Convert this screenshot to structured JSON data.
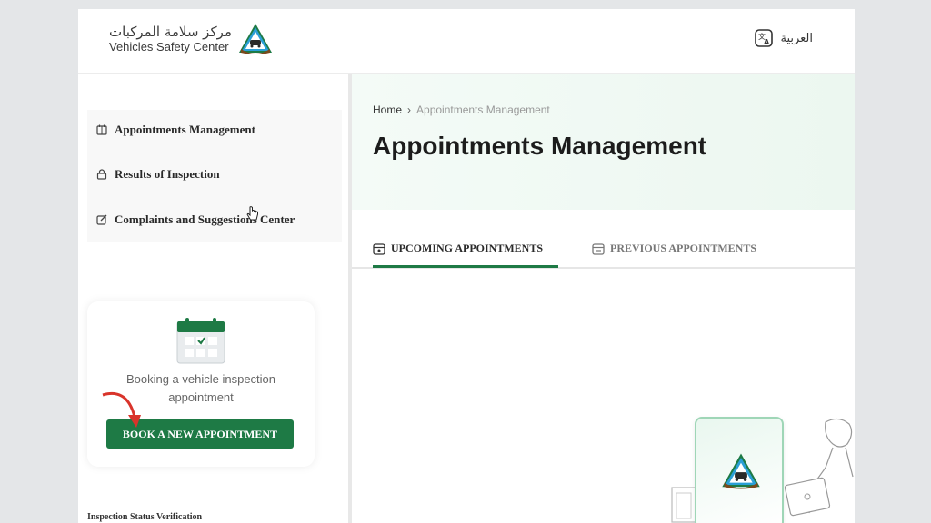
{
  "header": {
    "logo_ar": "مركز سلامة المركبات",
    "logo_en": "Vehicles Safety Center",
    "language_toggle": "العربية"
  },
  "sidebar": {
    "items": [
      {
        "label": "Appointments Management",
        "icon": "calendar-icon"
      },
      {
        "label": "Results of Inspection",
        "icon": "lock-icon"
      },
      {
        "label": "Complaints and Suggestions Center",
        "icon": "edit-icon"
      }
    ],
    "booking_card": {
      "text": "Booking a vehicle inspection appointment",
      "button_label": "BOOK A NEW APPOINTMENT"
    },
    "status_verification": "Inspection Status Verification"
  },
  "breadcrumb": {
    "home": "Home",
    "current": "Appointments Management"
  },
  "page_title": "Appointments Management",
  "tabs": [
    {
      "label": "UPCOMING APPOINTMENTS",
      "active": true
    },
    {
      "label": "PREVIOUS APPOINTMENTS",
      "active": false
    }
  ],
  "colors": {
    "accent": "#1e7a45",
    "annotation_arrow": "#d9342b"
  }
}
